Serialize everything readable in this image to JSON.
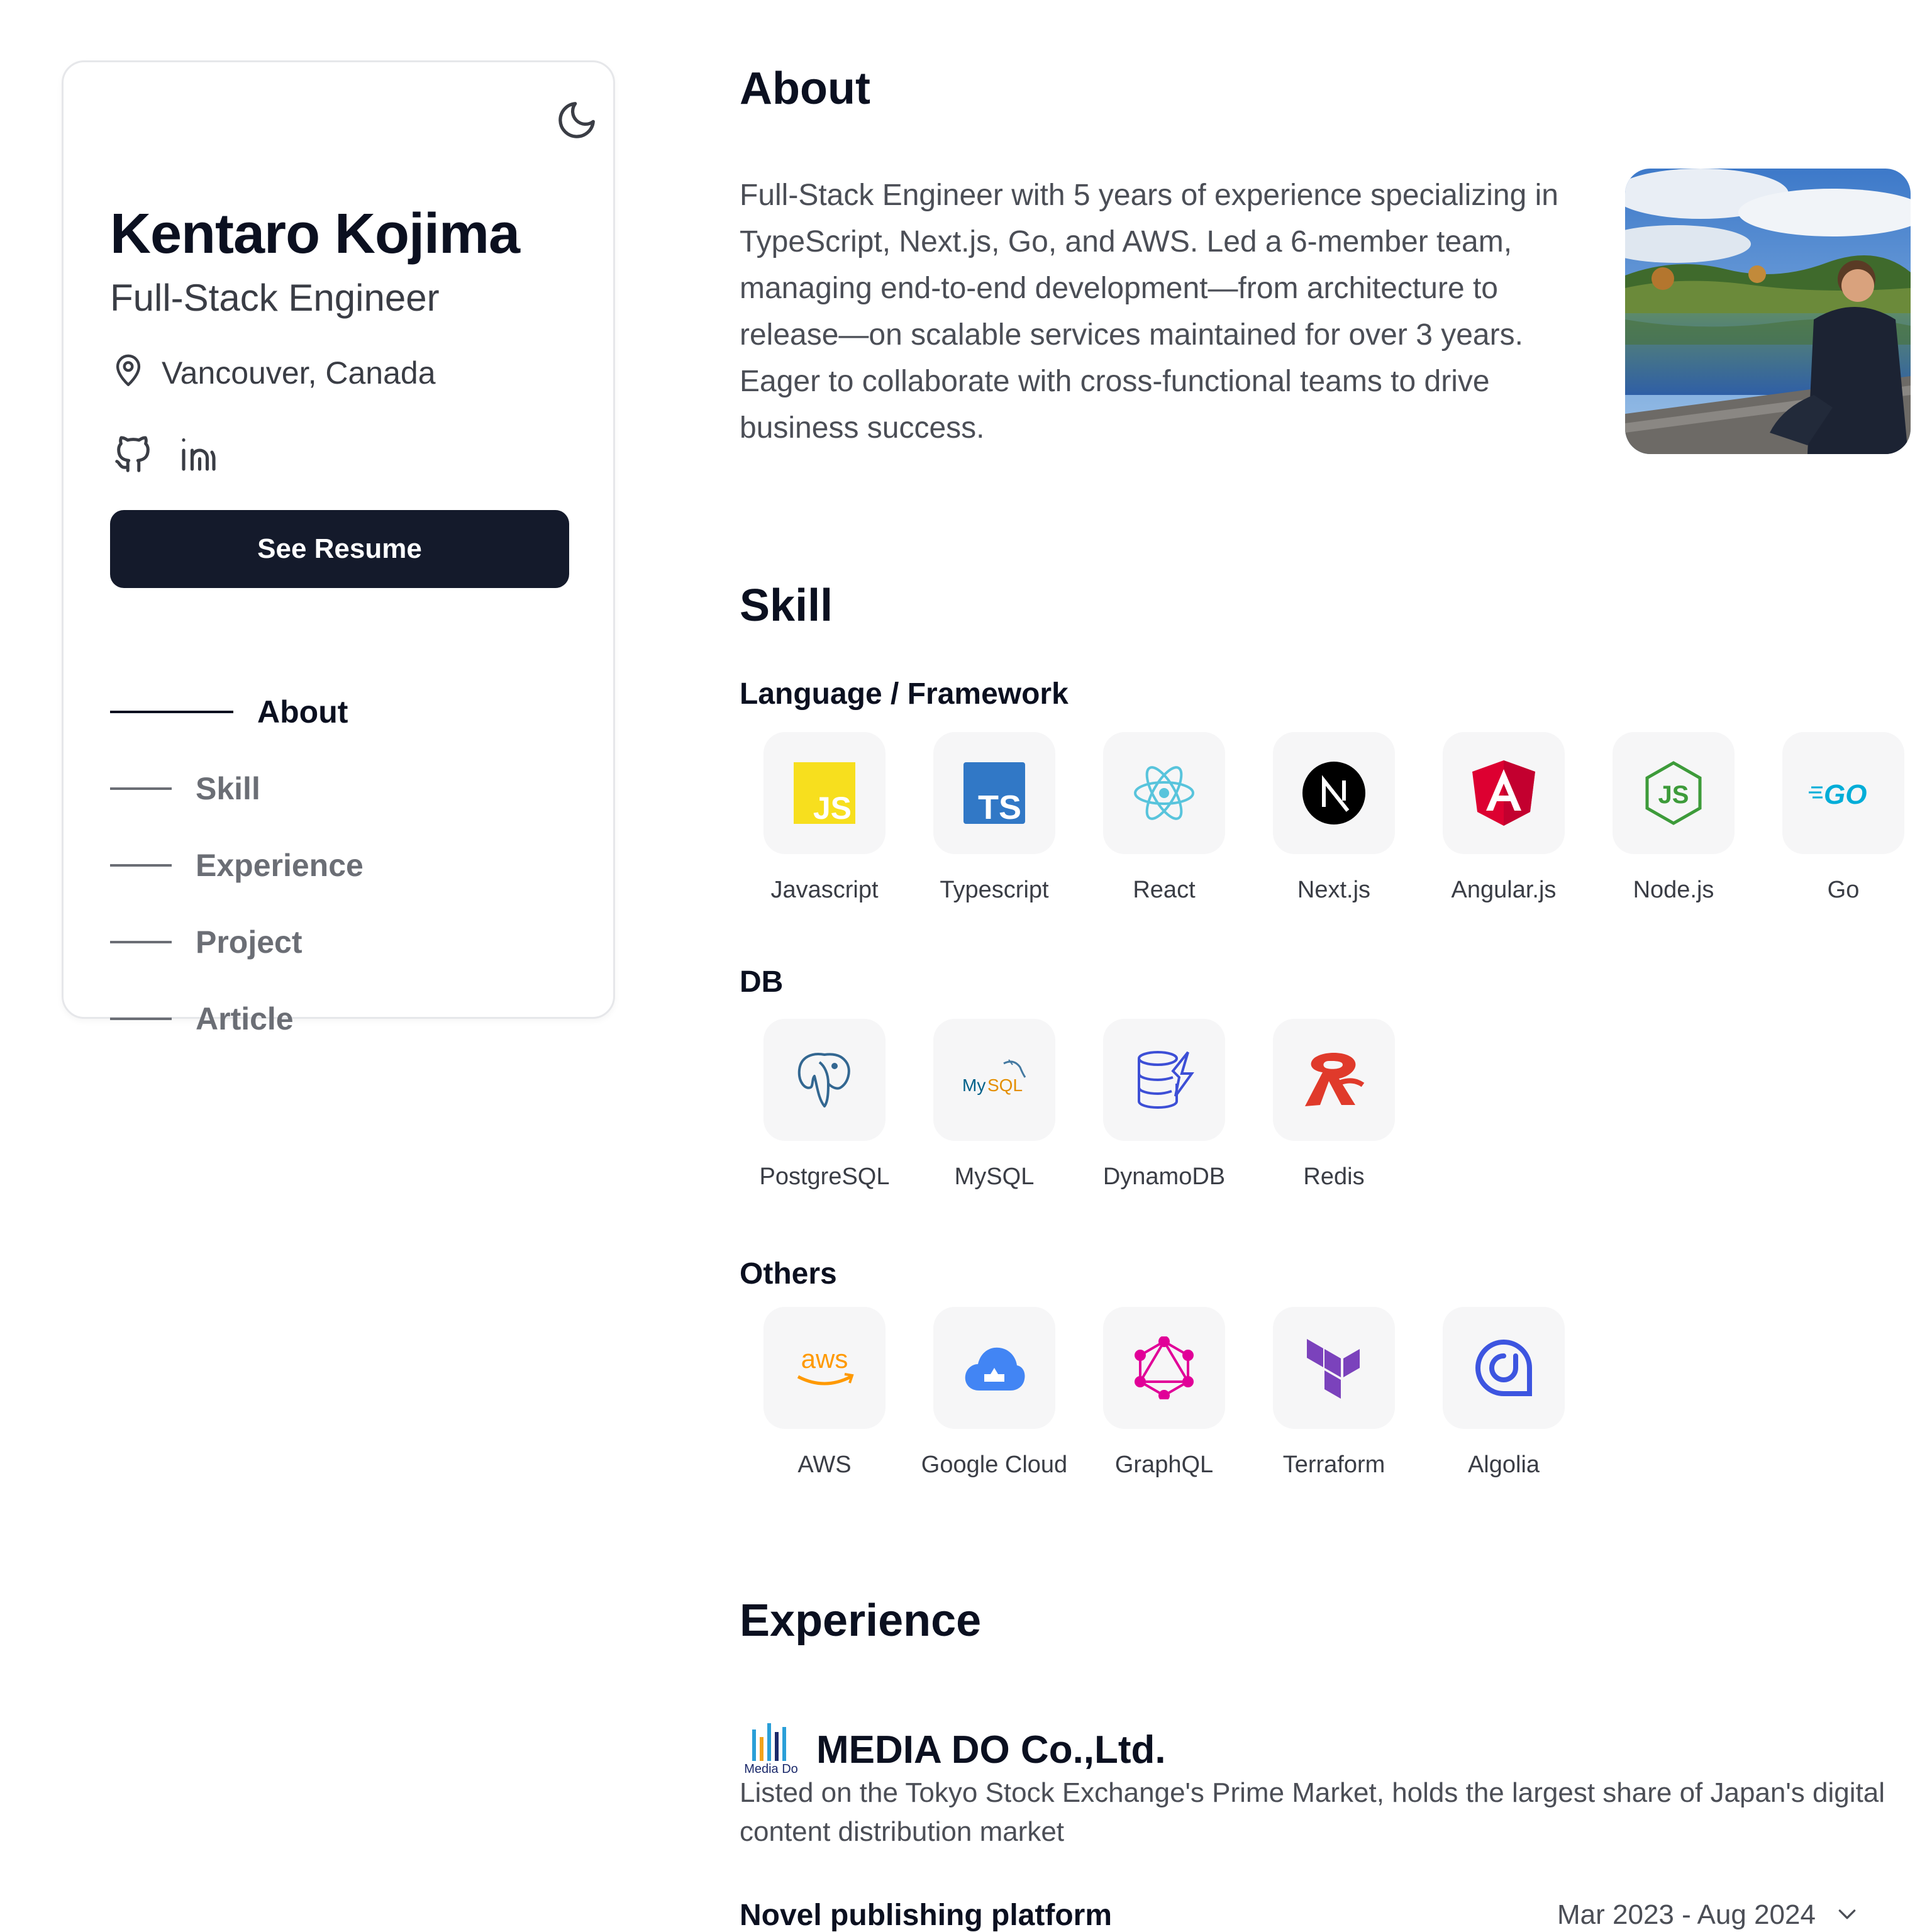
{
  "profile": {
    "name": "Kentaro Kojima",
    "title": "Full-Stack Engineer",
    "location": "Vancouver, Canada",
    "resume_button": "See Resume"
  },
  "nav": {
    "items": [
      {
        "label": "About",
        "active": true
      },
      {
        "label": "Skill",
        "active": false
      },
      {
        "label": "Experience",
        "active": false
      },
      {
        "label": "Project",
        "active": false
      },
      {
        "label": "Article",
        "active": false
      }
    ]
  },
  "about": {
    "heading": "About",
    "text": "Full-Stack Engineer with 5 years of experience specializing in TypeScript, Next.js, Go, and AWS. Led a 6-member team, managing end-to-end development—from architecture to release—on scalable services maintained for over 3 years. Eager to collaborate with cross-functional teams to drive business success."
  },
  "skill": {
    "heading": "Skill",
    "groups": [
      {
        "label": "Language / Framework",
        "items": [
          {
            "label": "Javascript",
            "icon": "javascript-icon"
          },
          {
            "label": "Typescript",
            "icon": "typescript-icon"
          },
          {
            "label": "React",
            "icon": "react-icon"
          },
          {
            "label": "Next.js",
            "icon": "nextjs-icon"
          },
          {
            "label": "Angular.js",
            "icon": "angular-icon"
          },
          {
            "label": "Node.js",
            "icon": "nodejs-icon"
          },
          {
            "label": "Go",
            "icon": "go-icon"
          }
        ]
      },
      {
        "label": "DB",
        "items": [
          {
            "label": "PostgreSQL",
            "icon": "postgresql-icon"
          },
          {
            "label": "MySQL",
            "icon": "mysql-icon"
          },
          {
            "label": "DynamoDB",
            "icon": "dynamodb-icon"
          },
          {
            "label": "Redis",
            "icon": "redis-icon"
          }
        ]
      },
      {
        "label": "Others",
        "items": [
          {
            "label": "AWS",
            "icon": "aws-icon"
          },
          {
            "label": "Google Cloud",
            "icon": "google-cloud-icon"
          },
          {
            "label": "GraphQL",
            "icon": "graphql-icon"
          },
          {
            "label": "Terraform",
            "icon": "terraform-icon"
          },
          {
            "label": "Algolia",
            "icon": "algolia-icon"
          }
        ]
      }
    ]
  },
  "experience": {
    "heading": "Experience",
    "company": "MEDIA DO Co.,Ltd.",
    "logo_text": "Media Do",
    "description": "Listed on the Tokyo Stock Exchange's Prime Market, holds the largest share of Japan's digital content distribution market",
    "role": "Novel publishing platform",
    "period": "Mar 2023 - Aug 2024"
  },
  "icons": {
    "theme_toggle": "moon-icon",
    "location": "map-pin-icon",
    "github": "github-icon",
    "linkedin": "linkedin-icon",
    "expand": "chevron-down-icon"
  },
  "colors": {
    "primary_button": "#141a2b",
    "text_dark": "#0b1020",
    "text_muted": "#4b4e56",
    "tile_bg": "#f6f6f7"
  }
}
